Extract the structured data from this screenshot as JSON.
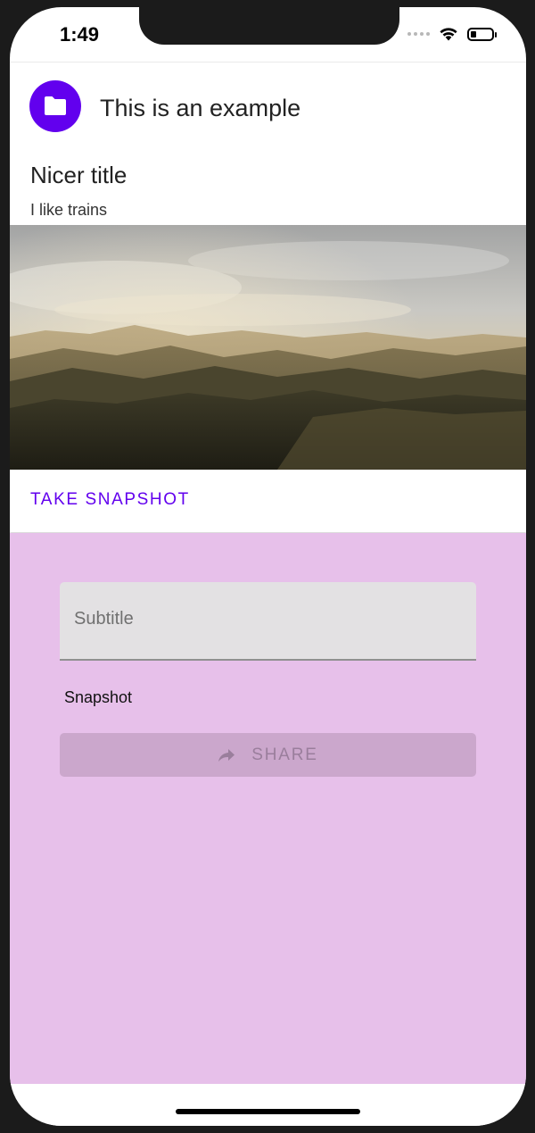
{
  "status_bar": {
    "time": "1:49"
  },
  "card": {
    "header_title": "This is an example",
    "avatar_icon": "folder-icon",
    "title": "Nicer title",
    "subtitle": "I like trains",
    "image": "mountain-landscape",
    "action_label": "TAKE SNAPSHOT"
  },
  "form": {
    "subtitle_placeholder": "Subtitle",
    "subtitle_value": "",
    "snapshot_label": "Snapshot",
    "share_label": "SHARE",
    "share_icon": "share-arrow-icon",
    "share_enabled": false
  },
  "colors": {
    "primary": "#6200ee",
    "form_background": "#e7c0ea",
    "disabled_button": "#cba7cc"
  }
}
